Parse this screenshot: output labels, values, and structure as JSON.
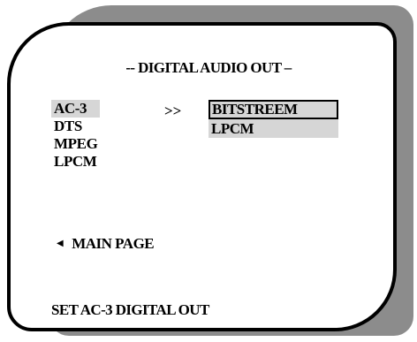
{
  "menu": {
    "title": "-- DIGITAL AUDIO OUT –",
    "formats": [
      {
        "label": "AC-3",
        "selected": true
      },
      {
        "label": "DTS",
        "selected": false
      },
      {
        "label": "MPEG",
        "selected": false
      },
      {
        "label": "LPCM",
        "selected": false
      }
    ],
    "submenu_arrow": ">>",
    "options": [
      {
        "label": "BITSTREEM",
        "focused": true
      },
      {
        "label": "LPCM",
        "focused": false
      }
    ],
    "back": {
      "icon": "left-triangle-icon",
      "label": "MAIN PAGE"
    },
    "status": "SET AC-3 DIGITAL OUT"
  },
  "colors": {
    "shadow": "#8c8c8c",
    "highlight": "#d6d6d6",
    "border": "#000000"
  }
}
